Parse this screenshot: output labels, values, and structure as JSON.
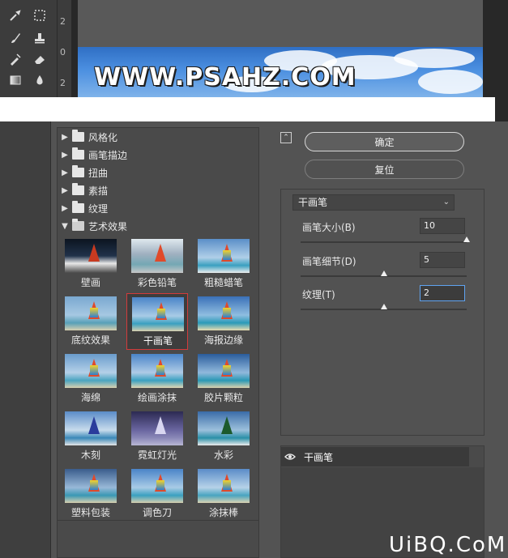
{
  "ruler": {
    "marks": [
      "2",
      "0",
      "2"
    ]
  },
  "canvas": {
    "watermark": "WWW.PSAHZ.COM"
  },
  "filter_gallery": {
    "categories": [
      {
        "label": "风格化",
        "expanded": false
      },
      {
        "label": "画笔描边",
        "expanded": false
      },
      {
        "label": "扭曲",
        "expanded": false
      },
      {
        "label": "素描",
        "expanded": false
      },
      {
        "label": "纹理",
        "expanded": false
      },
      {
        "label": "艺术效果",
        "expanded": true
      }
    ],
    "thumbnails": [
      "壁画",
      "彩色铅笔",
      "粗糙蜡笔",
      "底纹效果",
      "干画笔",
      "海报边缘",
      "海绵",
      "绘画涂抹",
      "胶片颗粒",
      "木刻",
      "霓虹灯光",
      "水彩",
      "塑料包装",
      "调色刀",
      "涂抹棒"
    ],
    "selected_thumbnail": "干画笔"
  },
  "actions": {
    "ok_label": "确定",
    "reset_label": "复位"
  },
  "settings": {
    "filter_select": "干画笔",
    "params": [
      {
        "label": "画笔大小(B)",
        "value": "10",
        "slider": 1.0
      },
      {
        "label": "画笔细节(D)",
        "value": "5",
        "slider": 0.5
      },
      {
        "label": "纹理(T)",
        "value": "2",
        "slider": 0.5
      }
    ]
  },
  "layers": {
    "items": [
      {
        "name": "干画笔"
      }
    ]
  },
  "footer": {
    "watermark": "UiBQ.CoM"
  },
  "colors": {
    "selection": "#d23b3b",
    "focus": "#5fa3f0",
    "panel": "#535353"
  }
}
